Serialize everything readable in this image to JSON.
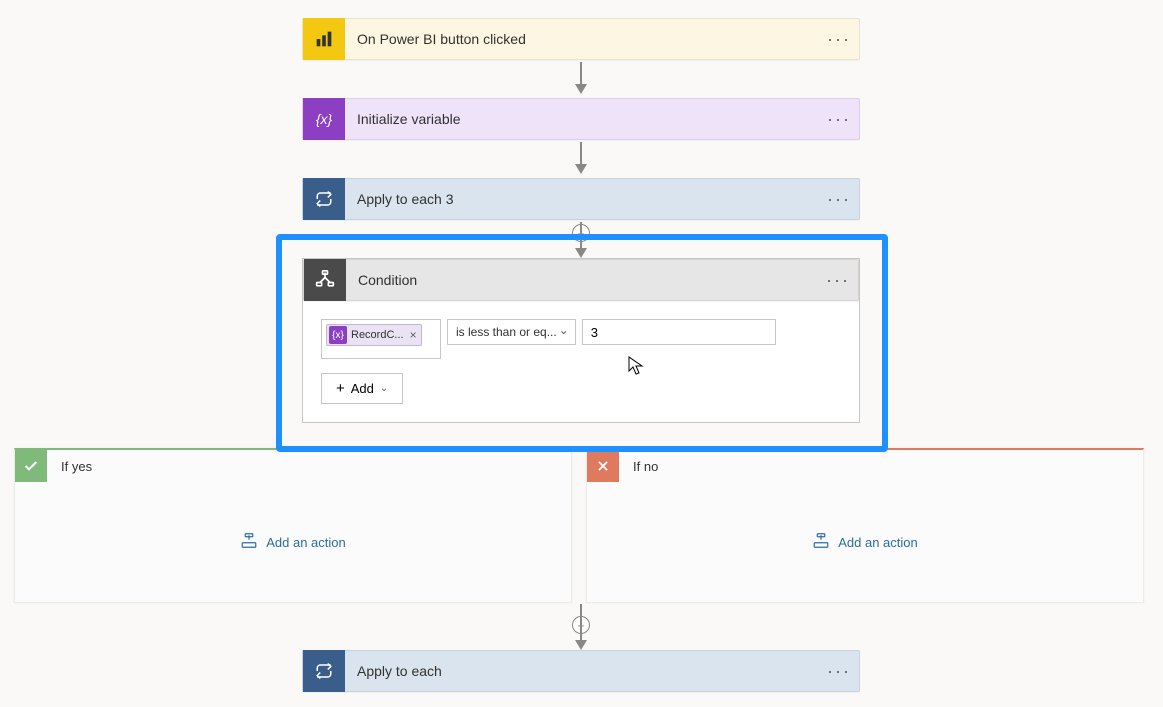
{
  "trigger": {
    "label": "On Power BI button clicked"
  },
  "init_variable": {
    "label": "Initialize variable"
  },
  "apply_each_3": {
    "label": "Apply to each 3"
  },
  "condition": {
    "label": "Condition",
    "token_label": "RecordC...",
    "operator_label": "is less than or eq...",
    "value": "3",
    "add_label": "Add"
  },
  "branch_yes": {
    "label": "If yes",
    "add_action_label": "Add an action"
  },
  "branch_no": {
    "label": "If no",
    "add_action_label": "Add an action"
  },
  "apply_each": {
    "label": "Apply to each"
  },
  "more_glyph": "···"
}
